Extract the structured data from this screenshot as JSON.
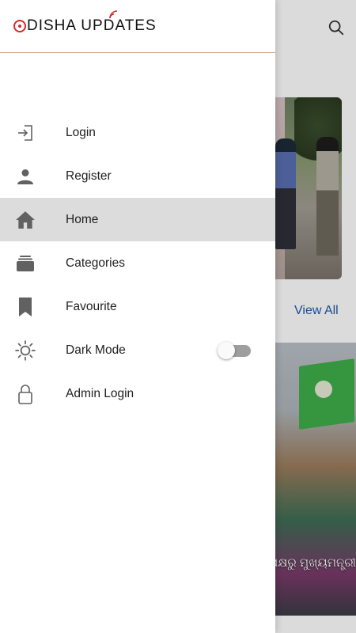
{
  "app": {
    "logo_text_pre": "DISHA UP",
    "logo_text_post": "ATES",
    "view_all_label": "View All",
    "article_caption": "ପକ୍ଷରୁ ମୁଖ୍ୟମନ୍ତ୍ରୀଙ୍କ ..."
  },
  "drawer": {
    "items": [
      {
        "label": "Login",
        "icon": "login-icon"
      },
      {
        "label": "Register",
        "icon": "person-icon"
      },
      {
        "label": "Home",
        "icon": "home-icon",
        "active": true
      },
      {
        "label": "Categories",
        "icon": "categories-icon"
      },
      {
        "label": "Favourite",
        "icon": "bookmark-icon"
      },
      {
        "label": "Dark Mode",
        "icon": "sun-icon",
        "toggle": false
      },
      {
        "label": "Admin Login",
        "icon": "lock-icon"
      }
    ]
  },
  "colors": {
    "brand_red": "#d42a2a",
    "link_blue": "#1e5aa8",
    "active_row": "#dcdcdc",
    "icon_gray": "#616161"
  }
}
